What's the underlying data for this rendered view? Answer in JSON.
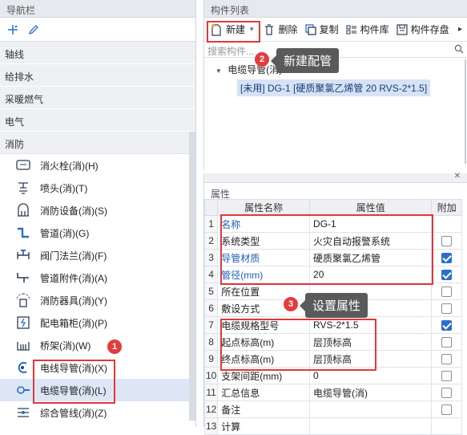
{
  "nav": {
    "title": "导航栏",
    "groups": [
      "轴线",
      "给排水",
      "采暖燃气",
      "电气",
      "消防"
    ],
    "items": [
      {
        "label": "消火栓(消)(H)",
        "icon": "hydrant-icon"
      },
      {
        "label": "喷头(消)(T)",
        "icon": "sprinkler-icon"
      },
      {
        "label": "消防设备(消)(S)",
        "icon": "fire-equipment-icon"
      },
      {
        "label": "管道(消)(G)",
        "icon": "pipe-icon"
      },
      {
        "label": "阀门法兰(消)(F)",
        "icon": "valve-icon"
      },
      {
        "label": "管道附件(消)(A)",
        "icon": "pipe-fitting-icon"
      },
      {
        "label": "消防器具(消)(Y)",
        "icon": "fire-extinguisher-icon"
      },
      {
        "label": "配电箱柜(消)(P)",
        "icon": "distribution-box-icon"
      },
      {
        "label": "桥架(消)(W)",
        "icon": "cable-tray-icon"
      },
      {
        "label": "电线导管(消)(X)",
        "icon": "wire-conduit-icon"
      },
      {
        "label": "电缆导管(消)(L)",
        "icon": "cable-conduit-icon"
      },
      {
        "label": "综合管线(消)(Z)",
        "icon": "combined-pipeline-icon"
      }
    ]
  },
  "component_list": {
    "title": "构件列表",
    "toolbar": {
      "new": "新建",
      "delete": "删除",
      "copy": "复制",
      "library": "构件库",
      "save": "构件存盘"
    },
    "search_placeholder": "搜索构件...",
    "tree_root": "电缆导管(消)",
    "tree_leaf": "[未用] DG-1 [硬质聚氯乙烯管 20 RVS-2*1.5]"
  },
  "callouts": {
    "c1": {
      "num": "1"
    },
    "c2": {
      "num": "2",
      "text": "新建配管"
    },
    "c3": {
      "num": "3",
      "text": "设置属性"
    }
  },
  "properties": {
    "title": "属性",
    "headers": {
      "name": "属性名称",
      "value": "属性值",
      "add": "附加"
    },
    "rows": [
      {
        "n": "1",
        "name": "名称",
        "value": "DG-1",
        "blue": true,
        "checkbox": null
      },
      {
        "n": "2",
        "name": "系统类型",
        "value": "火灾自动报警系统",
        "blue": false,
        "checkbox": false
      },
      {
        "n": "3",
        "name": "导管材质",
        "value": "硬质聚氯乙烯管",
        "blue": true,
        "checkbox": true
      },
      {
        "n": "4",
        "name": "管径(mm)",
        "value": "20",
        "blue": true,
        "checkbox": true
      },
      {
        "n": "5",
        "name": "所在位置",
        "value": "",
        "blue": false,
        "checkbox": false
      },
      {
        "n": "6",
        "name": "敷设方式",
        "value": "",
        "blue": false,
        "checkbox": false
      },
      {
        "n": "7",
        "name": "电缆规格型号",
        "value": "RVS-2*1.5",
        "blue": false,
        "checkbox": true
      },
      {
        "n": "8",
        "name": "起点标高(m)",
        "value": "层顶标高",
        "blue": false,
        "checkbox": false
      },
      {
        "n": "9",
        "name": "终点标高(m)",
        "value": "层顶标高",
        "blue": false,
        "checkbox": false
      },
      {
        "n": "10",
        "name": "支架间距(mm)",
        "value": "0",
        "blue": false,
        "checkbox": false
      },
      {
        "n": "11",
        "name": "汇总信息",
        "value": "电缆导管(消)",
        "blue": false,
        "checkbox": false
      },
      {
        "n": "12",
        "name": "备注",
        "value": "",
        "blue": false,
        "checkbox": false
      },
      {
        "n": "13",
        "name": "计算",
        "value": "",
        "blue": false,
        "checkbox": null
      }
    ]
  }
}
